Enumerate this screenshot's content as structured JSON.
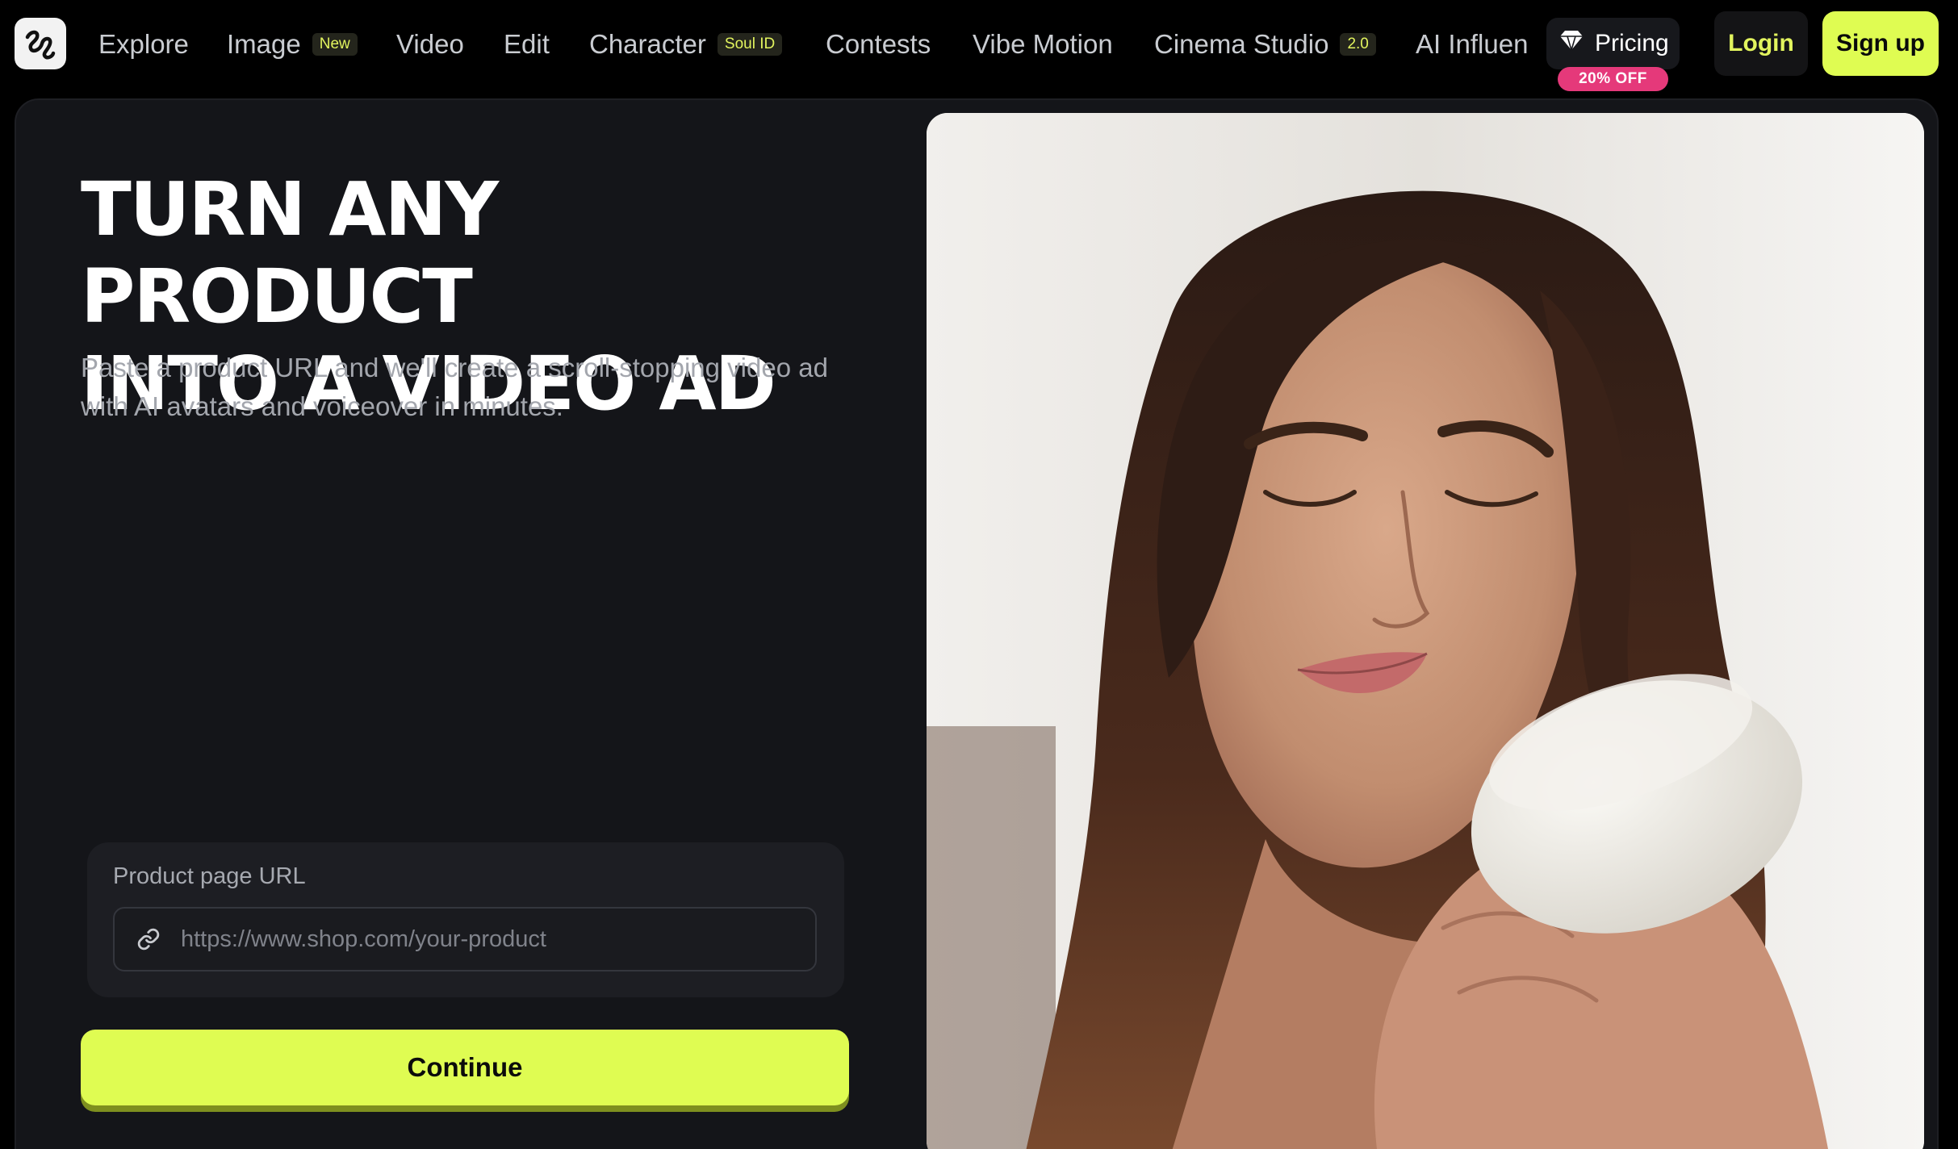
{
  "nav": {
    "items": [
      {
        "label": "Explore"
      },
      {
        "label": "Image",
        "badge": "New"
      },
      {
        "label": "Video"
      },
      {
        "label": "Edit"
      },
      {
        "label": "Character",
        "badge": "Soul ID"
      },
      {
        "label": "Contests"
      },
      {
        "label": "Vibe Motion"
      },
      {
        "label": "Cinema Studio",
        "badge": "2.0"
      },
      {
        "label": "AI Influen"
      }
    ],
    "pricing_label": "Pricing",
    "pricing_badge": "20% OFF",
    "login_label": "Login",
    "signup_label": "Sign up"
  },
  "hero": {
    "title_line1": "TURN ANY PRODUCT",
    "title_line2": "INTO A VIDEO AD",
    "subtitle_line1": "Paste a product URL and we'll create a scroll-stopping video ad",
    "subtitle_line2": "with AI avatars and voiceover in minutes."
  },
  "form": {
    "url_label": "Product page URL",
    "url_placeholder": "https://www.shop.com/your-product",
    "url_value": "",
    "continue_label": "Continue"
  },
  "colors": {
    "accent": "#dffc52",
    "badge_pink": "#e5397a",
    "panel_bg": "#141519"
  },
  "icons": {
    "logo": "app-logo-icon",
    "pricing": "gem-icon",
    "url_field": "link-icon"
  }
}
